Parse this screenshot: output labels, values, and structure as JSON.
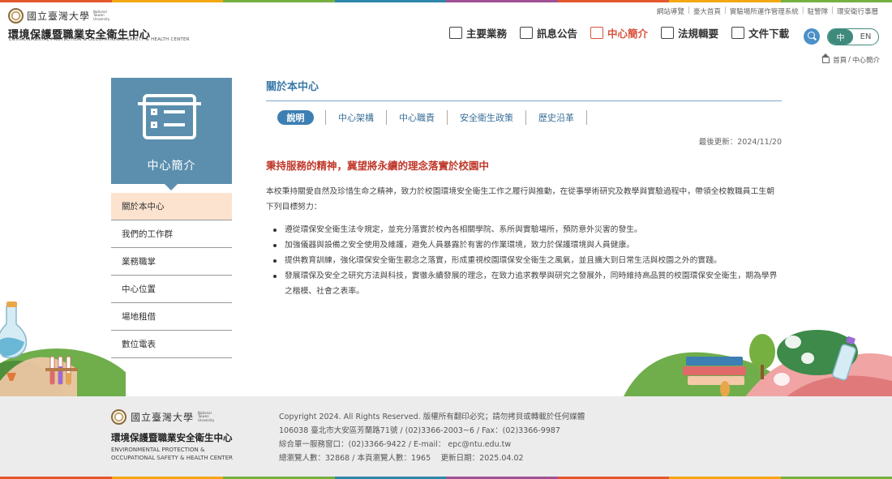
{
  "brand": {
    "ntu_calligraphy": "國立臺灣大學",
    "ntu_en": "National Taiwan University",
    "title": "環境保護暨職業安全衛生中心",
    "subtitle": "ENVIRONMENTAL PROTECTION & OCCUPATIONAL SAFETY & HEALTH CENTER"
  },
  "toplinks": [
    "網站導覽",
    "臺大首頁",
    "實驗場所運作管理系統",
    "駐警隊",
    "環安衛行事曆"
  ],
  "nav": {
    "items": [
      {
        "label": "主要業務",
        "icon": "people-icon",
        "active": false
      },
      {
        "label": "訊息公告",
        "icon": "news-icon",
        "active": false
      },
      {
        "label": "中心簡介",
        "icon": "board-icon",
        "active": true
      },
      {
        "label": "法規輯要",
        "icon": "book-icon",
        "active": false
      },
      {
        "label": "文件下載",
        "icon": "download-icon",
        "active": false
      }
    ],
    "lang_zh": "中",
    "lang_en": "EN"
  },
  "breadcrumb": {
    "home": "首頁",
    "separator": "/",
    "current": "中心簡介"
  },
  "sidebar": {
    "title": "中心簡介",
    "items": [
      "關於本中心",
      "我們的工作群",
      "業務職掌",
      "中心位置",
      "場地租借",
      "數位電表"
    ]
  },
  "main": {
    "title": "關於本中心",
    "tabs": [
      "說明",
      "中心架構",
      "中心職責",
      "安全衛生政策",
      "歷史沿革"
    ],
    "updated": "最後更新：2024/11/20",
    "headline": "秉持服務的精神，冀望將永續的理念落實於校園中",
    "intro": "本校秉持關愛自然及珍惜生命之精神，致力於校園環境安全衛生工作之履行與推動，在從事學術研究及教學與實驗過程中，帶領全校教職員工生朝下列目標努力：",
    "bullets": [
      "遵從環保安全衛生法令規定，並充分落實於校內各相關學院、系所與實驗場所，預防意外災害的發生。",
      "加強儀器與設備之安全使用及維護，避免人員暴露於有害的作業環境，致力於保護環境與人員健康。",
      "提供教育訓練，強化環保安全衛生觀念之落實，形成重視校園環保安全衛生之風氣，並且擴大到日常生活與校園之外的實踐。",
      "發展環保及安全之研究方法與科技，實徹永續發展的理念，在致力追求教學與研究之發展外，同時維持高品質的校園環保安全衛生，期為學界之楷模、社會之表率。"
    ]
  },
  "footer": {
    "title": "環境保護暨職業安全衛生中心",
    "sub1": "ENVIRONMENTAL PROTECTION &",
    "sub2": "OCCUPATIONAL SAFETY & HEALTH CENTER",
    "lines": [
      "Copyright 2024. All Rights Reserved. 版權所有翻印必究；請勿拷貝或轉載於任何媒體",
      "106038 臺北市大安區芳蘭路71號 / (02)3366-2003~6 / Fax：(02)3366-9987",
      "綜合單一服務窗口：(02)3366-9422 / E-mail： epc@ntu.edu.tw",
      "總瀏覽人數：32868 / 本頁瀏覽人數：1965　 更新日期：2025.04.02"
    ]
  },
  "colors": {
    "accent": "#3d7fb2",
    "sidebar": "#5c8fae",
    "active_nav": "#d9533f",
    "headline": "#c0392b",
    "stripe": [
      "#e4572e",
      "#f3a712",
      "#76b041",
      "#2e86ab",
      "#a05195",
      "#e4572e",
      "#f3a712",
      "#76b041"
    ]
  }
}
